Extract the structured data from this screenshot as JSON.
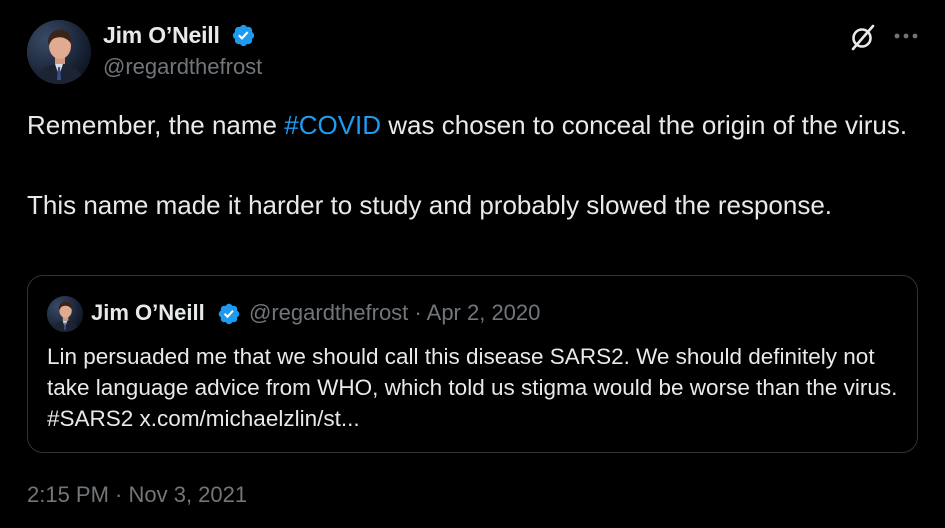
{
  "author": {
    "display_name": "Jim O’Neill",
    "handle": "@regardthefrost",
    "verified": true
  },
  "tweet": {
    "text_before_hashtag": "Remember, the name ",
    "hashtag": "#COVID",
    "text_after_hashtag": " was chosen to conceal the origin of the virus.",
    "paragraph_2": "This name made it harder to study and probably slowed the response."
  },
  "quoted_tweet": {
    "display_name": "Jim O’Neill",
    "handle": "@regardthefrost",
    "separator": " · ",
    "date": "Apr 2, 2020",
    "text": "Lin persuaded me that we should call this disease SARS2. We should definitely not take language advice from WHO, which told us stigma would be worse than the virus. #SARS2 x.com/michaelzlin/st..."
  },
  "timestamp": "2:15 PM · Nov 3, 2021",
  "icons": {
    "verified": "verified-badge-icon",
    "grok": "grok-icon",
    "more": "more-options-icon"
  },
  "colors": {
    "background": "#000000",
    "primary_text": "#e7e9ea",
    "secondary_text": "#71767b",
    "accent": "#1d9bf0",
    "border": "#2f3336"
  }
}
